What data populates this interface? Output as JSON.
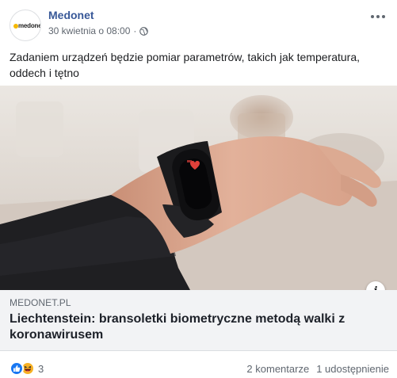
{
  "post": {
    "page_name": "Medonet",
    "avatar_logo_text": "medonet",
    "date": "30 kwietnia o 08:00",
    "separator": "·",
    "privacy_icon": "globe-icon",
    "more_icon": "more-options-icon",
    "text": "Zadaniem urządzeń będzie pomiar parametrów, takich jak temperatura, oddech i tętno"
  },
  "link_preview": {
    "domain": "MEDONET.PL",
    "title": "Liechtenstein: bransoletki biometryczne metodą walki z koronawirusem",
    "info_icon_label": "i"
  },
  "footer": {
    "reaction_icons": [
      "like-icon",
      "haha-icon"
    ],
    "reaction_count": "3",
    "comments": "2 komentarze",
    "shares": "1 udostępnienie"
  },
  "colors": {
    "page_name": "#385898",
    "secondary_text": "#606770",
    "link_box_bg": "#f2f3f5",
    "like_blue": "#1877f2",
    "haha_yellow": "#f7b125",
    "logo_dot": "#f5b800"
  }
}
